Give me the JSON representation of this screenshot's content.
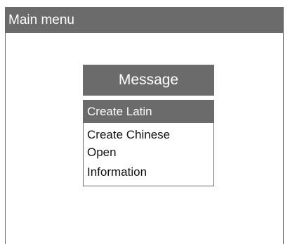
{
  "window": {
    "title": "Main menu"
  },
  "menu": {
    "header": "Message",
    "items": [
      {
        "label": "Create Latin",
        "selected": true
      },
      {
        "label": "Create Chinese",
        "selected": false
      },
      {
        "label": "Open",
        "selected": false
      },
      {
        "label": "Information",
        "selected": false
      }
    ]
  },
  "colors": {
    "bar": "#6b6b6b",
    "selected_bg": "#6b6b6b",
    "text_on_dark": "#ffffff",
    "background": "#ffffff"
  }
}
